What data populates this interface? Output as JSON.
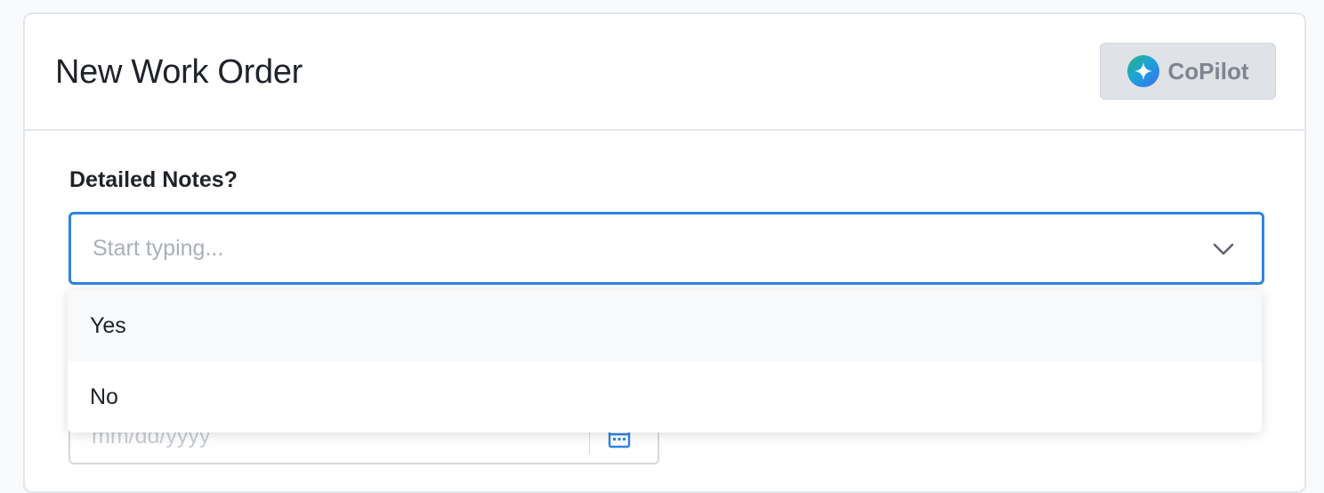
{
  "header": {
    "title": "New Work Order",
    "copilot_label": "CoPilot"
  },
  "form": {
    "detailed_notes": {
      "label": "Detailed Notes?",
      "placeholder": "Start typing...",
      "value": "",
      "options": [
        "Yes",
        "No"
      ],
      "highlighted_option": "Yes"
    },
    "date": {
      "placeholder": "mm/dd/yyyy"
    }
  },
  "colors": {
    "focus_border": "#2f84e2",
    "copilot_bg": "#dfe2e6",
    "copilot_text": "#7d8590",
    "calendar_icon": "#2f84e2"
  },
  "icons": {
    "copilot": "sparkle-icon",
    "dropdown": "chevron-down-icon",
    "date": "calendar-icon"
  }
}
